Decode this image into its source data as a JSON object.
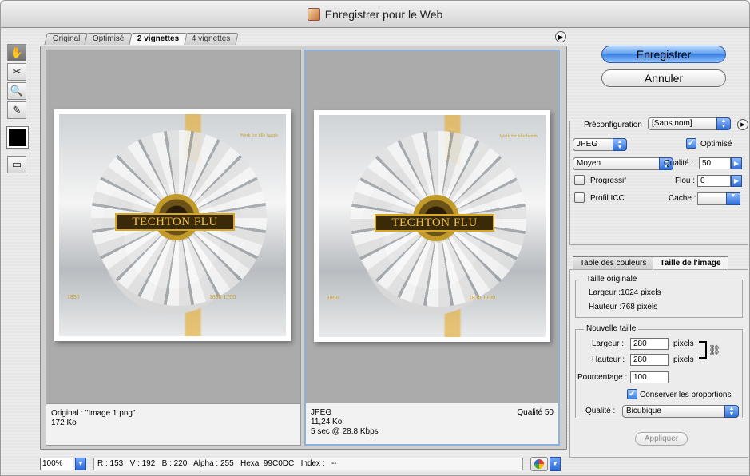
{
  "window": {
    "title": "Enregistrer pour le Web"
  },
  "tabs": [
    "Original",
    "Optimisé",
    "2 vignettes",
    "4 vignettes"
  ],
  "active_tab": "2 vignettes",
  "tools": [
    "hand-icon",
    "slice-select-icon",
    "zoom-icon",
    "eyedropper-icon"
  ],
  "eyedropper_color": "#000000",
  "preview": {
    "image_text": {
      "banner": "TECHTON FLU",
      "tagline": "Work for idle hands",
      "year1": "1850",
      "year2": "1830",
      "year3": "1700"
    },
    "left": {
      "line1": "Original : \"Image 1.png\"",
      "line2": "172 Ko"
    },
    "right": {
      "line1": "JPEG",
      "line2": "11,24 Ko",
      "line3": "5 sec @ 28.8 Kbps",
      "quality": "Qualité 50"
    }
  },
  "statusbar": {
    "zoom": "100%",
    "readout": "R : 153   V : 192   B : 220   Alpha : 255   Hexa  99C0DC   Index :   --"
  },
  "buttons": {
    "save": "Enregistrer",
    "cancel": "Annuler",
    "apply": "Appliquer"
  },
  "settings": {
    "preset_label": "Préconfiguration",
    "preset_value": "[Sans nom]",
    "format": "JPEG",
    "optimized_label": "Optimisé",
    "quality_level": "Moyen",
    "quality_label": "Qualité :",
    "quality_value": "50",
    "progressive_label": "Progressif",
    "blur_label": "Flou :",
    "blur_value": "0",
    "icc_label": "Profil ICC",
    "matte_label": "Cache :"
  },
  "image_size": {
    "tabs": [
      "Table des couleurs",
      "Taille de l'image"
    ],
    "original_legend": "Taille originale",
    "orig_width": "Largeur :1024 pixels",
    "orig_height": "Hauteur :768 pixels",
    "new_legend": "Nouvelle taille",
    "width_label": "Largeur :",
    "width_value": "280",
    "height_label": "Hauteur :",
    "height_value": "280",
    "pixels": "pixels",
    "percent_label": "Pourcentage :",
    "percent_value": "100",
    "constrain_label": "Conserver les proportions",
    "resample_label": "Qualité :",
    "resample_value": "Bicubique"
  }
}
